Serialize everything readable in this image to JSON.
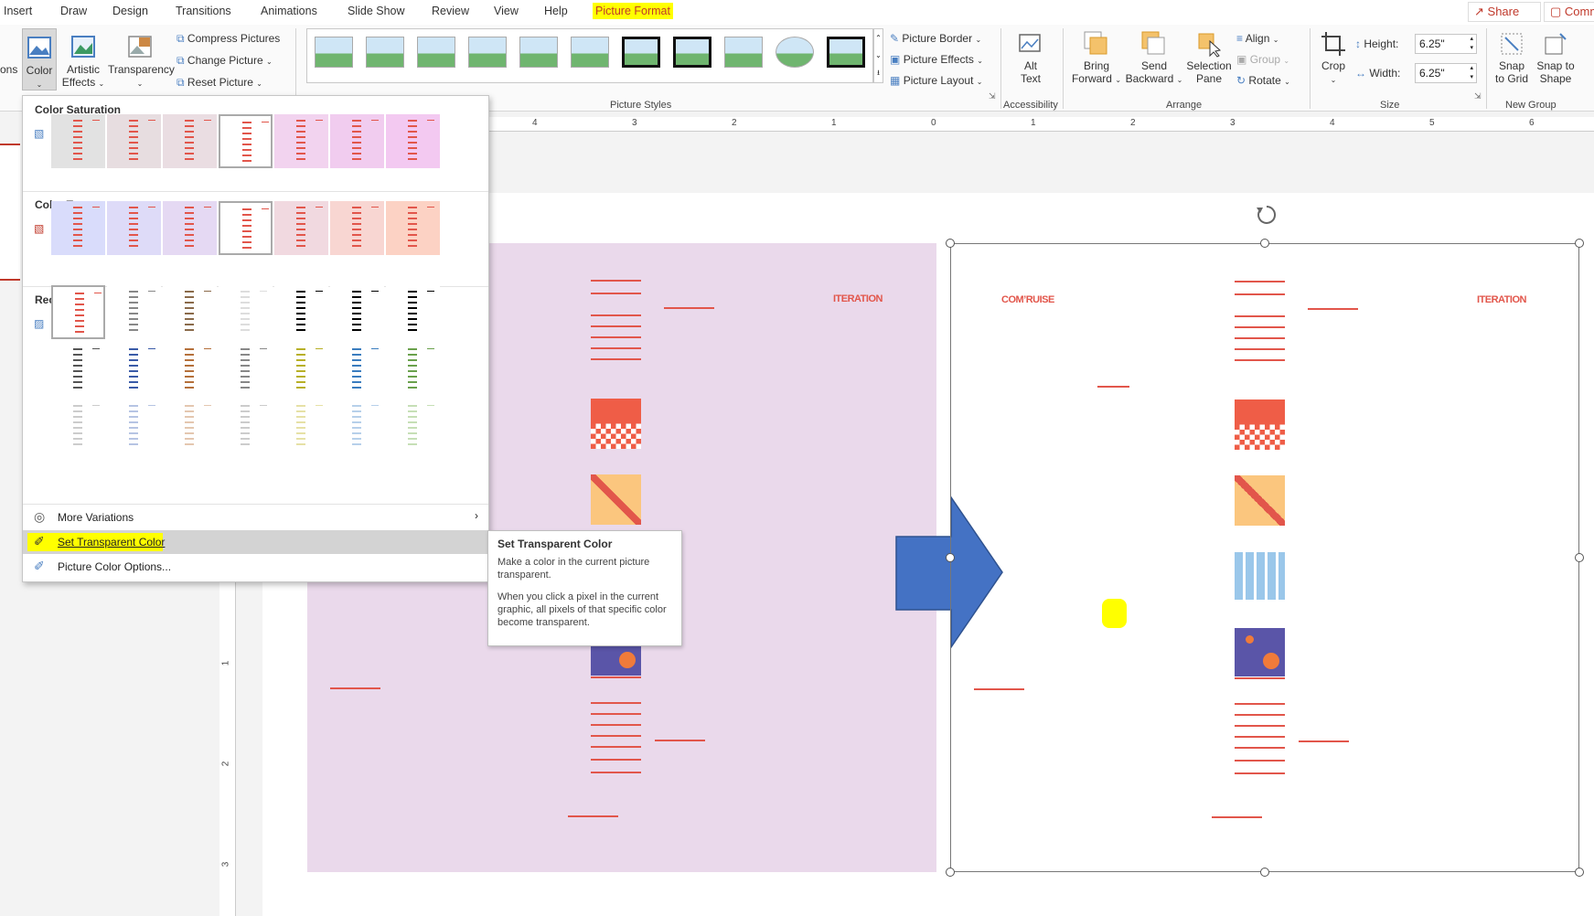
{
  "tabs": [
    "Insert",
    "Draw",
    "Design",
    "Transitions",
    "Animations",
    "Slide Show",
    "Review",
    "View",
    "Help",
    "Picture Format"
  ],
  "share_label": "Share",
  "comments_label": "Comm",
  "ribbon": {
    "left_cut_label": "ons",
    "color_label": "Color",
    "artistic_effects": [
      "Artistic",
      "Effects"
    ],
    "transparency_label": "Transparency",
    "compress_label": "Compress Pictures",
    "change_picture_label": "Change Picture",
    "reset_picture_label": "Reset Picture",
    "picture_styles_label": "Picture Styles",
    "picture_border_label": "Picture Border",
    "picture_effects_label": "Picture Effects",
    "picture_layout_label": "Picture Layout",
    "alt_text": [
      "Alt",
      "Text"
    ],
    "accessibility_label": "Accessibility",
    "bring_forward": [
      "Bring",
      "Forward"
    ],
    "send_backward": [
      "Send",
      "Backward"
    ],
    "selection_pane": [
      "Selection",
      "Pane"
    ],
    "align_label": "Align",
    "group_label": "Group",
    "rotate_label": "Rotate",
    "arrange_label": "Arrange",
    "crop_label": "Crop",
    "height_label": "Height:",
    "height_value": "6.25\"",
    "width_label": "Width:",
    "width_value": "6.25\"",
    "size_label": "Size",
    "snap_grid": [
      "Snap",
      "to Grid"
    ],
    "snap_shape": [
      "Snap to",
      "Shape"
    ],
    "new_group_label": "New Group"
  },
  "ruler_h_ticks": [
    "4",
    "3",
    "2",
    "1",
    "0",
    "1",
    "2",
    "3",
    "4",
    "5",
    "6"
  ],
  "ruler_v_ticks": [
    "1",
    "2",
    "3"
  ],
  "menu": {
    "color_saturation": "Color Saturation",
    "color_tone": "Color Tone",
    "recolor": "Recolor",
    "more_variations": "More Variations",
    "set_transparent": "Set Transparent Color",
    "picture_color_options": "Picture Color Options..."
  },
  "tooltip": {
    "title": "Set Transparent Color",
    "line1": "Make a color in the current picture transparent.",
    "line2": "When you click a pixel in the current graphic, all pixels of that specific color become transparent."
  },
  "picture_text": {
    "iteration": "ITERATION",
    "compromise": "COM’RUISE"
  },
  "colors": {
    "accent_red": "#e2564b",
    "highlight": "#ffff00",
    "arrow_blue": "#4472c4",
    "pink_bg": "#ead9eb"
  }
}
